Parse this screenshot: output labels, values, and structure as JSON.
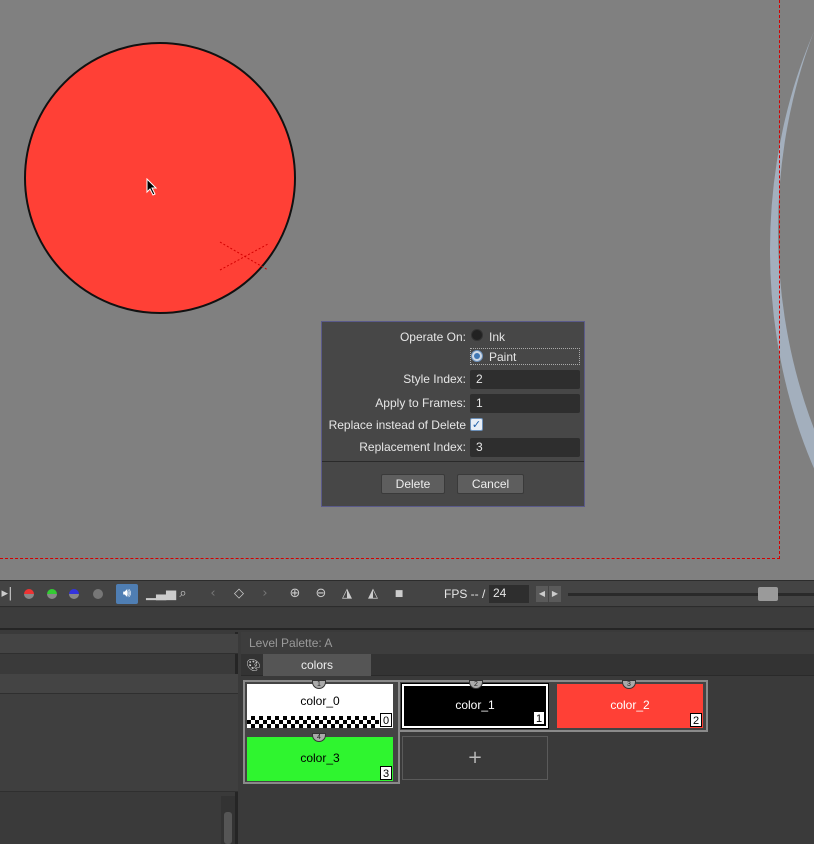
{
  "dialog": {
    "operate_on_label": "Operate On:",
    "ink_label": "Ink",
    "paint_label": "Paint",
    "style_index_label": "Style Index:",
    "style_index_value": "2",
    "apply_frames_label": "Apply to Frames:",
    "apply_frames_value": "1",
    "replace_label": "Replace instead of Delete",
    "replacement_index_label": "Replacement Index:",
    "replacement_index_value": "3",
    "delete_button": "Delete",
    "cancel_button": "Cancel"
  },
  "toolbar": {
    "fps_label": "FPS -- /",
    "fps_value": "24"
  },
  "palette": {
    "title": "Level Palette: A",
    "tab": "colors",
    "add_symbol": "+",
    "chips": [
      {
        "name": "color_0",
        "index": "0",
        "tag": "1",
        "color": "#ffffff"
      },
      {
        "name": "color_1",
        "index": "1",
        "tag": "2",
        "color": "#000000"
      },
      {
        "name": "color_2",
        "index": "2",
        "tag": "3",
        "color": "#ff4036"
      },
      {
        "name": "color_3",
        "index": "3",
        "tag": "4",
        "color": "#2ff52f"
      }
    ]
  },
  "colors": {
    "circle_fill": "#ff4036",
    "accent": "#3f76b3"
  }
}
